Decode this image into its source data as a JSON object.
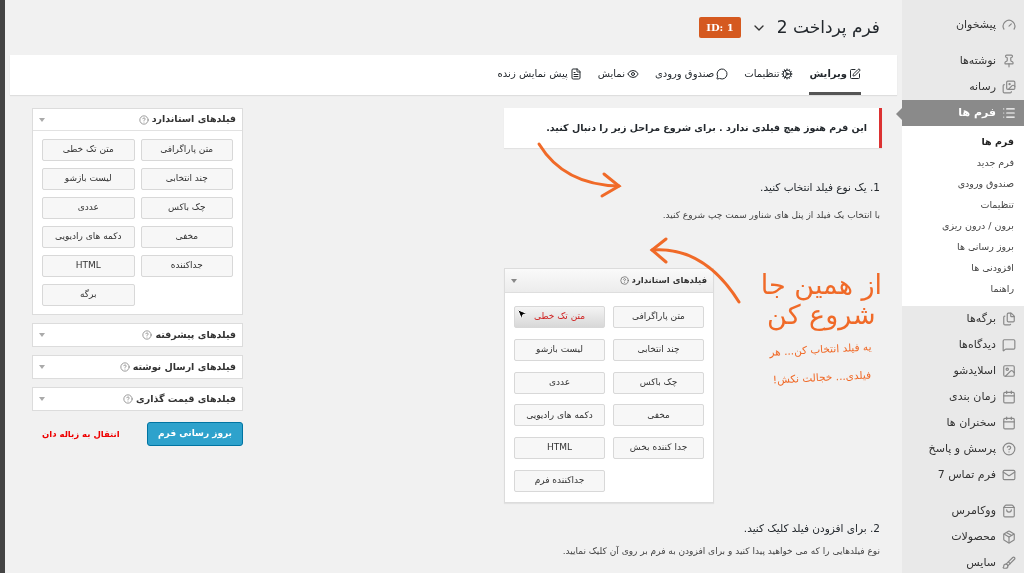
{
  "sidebar": {
    "items": [
      {
        "kind": "item",
        "label": "پیشخوان",
        "selected": false
      },
      {
        "kind": "separator"
      },
      {
        "kind": "item",
        "label": "نوشته‌ها",
        "selected": false
      },
      {
        "kind": "item",
        "label": "رسانه",
        "selected": false
      },
      {
        "kind": "item",
        "label": "فرم ها",
        "selected": true,
        "children": [
          {
            "label": "فرم ها",
            "selected": true
          },
          {
            "label": "فرم جدید",
            "selected": false
          },
          {
            "label": "صندوق ورودی",
            "selected": false
          },
          {
            "label": "تنظیمات",
            "selected": false
          },
          {
            "label": "برون / درون ریزی",
            "selected": false
          },
          {
            "label": "بروز رسانی ها",
            "selected": false
          },
          {
            "label": "افزودنی ها",
            "selected": false
          },
          {
            "label": "راهنما",
            "selected": false
          }
        ]
      },
      {
        "kind": "item",
        "label": "برگه‌ها",
        "selected": false
      },
      {
        "kind": "item",
        "label": "دیدگاه‌ها",
        "selected": false
      },
      {
        "kind": "item",
        "label": "اسلایدشو",
        "selected": false
      },
      {
        "kind": "item",
        "label": "زمان بندی",
        "selected": false
      },
      {
        "kind": "item",
        "label": "سخنران ها",
        "selected": false
      },
      {
        "kind": "item",
        "label": "پرسش و پاسخ",
        "selected": false
      },
      {
        "kind": "item",
        "label": "فرم تماس 7",
        "selected": false
      },
      {
        "kind": "separator"
      },
      {
        "kind": "item",
        "label": "ووکامرس",
        "selected": false
      },
      {
        "kind": "item",
        "label": "محصولات",
        "selected": false
      },
      {
        "kind": "item",
        "label": "سایس",
        "selected": false
      }
    ]
  },
  "header": {
    "title": "فرم پرداخت 2",
    "id_badge": "ID: 1"
  },
  "tabs": [
    {
      "label": "ویرایش",
      "selected": true
    },
    {
      "label": "تنظیمات",
      "selected": false
    },
    {
      "label": "صندوق ورودی",
      "selected": false
    },
    {
      "label": "نمایش",
      "selected": false
    },
    {
      "label": "پیش نمایش زنده",
      "selected": false
    }
  ],
  "notice": "این فرم هنوز هیچ فیلدی ندارد . برای شروع مراحل زیر را دنبال کنید.",
  "steps": [
    {
      "heading": "1. یک نوع فیلد انتخاب کنید.",
      "text": "با انتخاب یک فیلد از پنل های شناور سمت چپ شروع کنید."
    },
    {
      "heading": "2. برای افزودن فیلد کلیک کنید.",
      "text": "نوع فیلدهایی را که می خواهید پیدا کنید و برای افزودن به فرم بر روی آن کلیک نمایید."
    }
  ],
  "tutorial": {
    "panel_title": "فیلدهای استاندارد",
    "buttons": [
      {
        "label": "متن پاراگرافی",
        "hovered": false
      },
      {
        "label": "متن تک خطی",
        "hovered": true
      },
      {
        "label": "چند انتخابی",
        "hovered": false
      },
      {
        "label": "لیست بازشو",
        "hovered": false
      },
      {
        "label": "چک باکس",
        "hovered": false
      },
      {
        "label": "عددی",
        "hovered": false
      },
      {
        "label": "مخفی",
        "hovered": false
      },
      {
        "label": "دکمه های رادیویی",
        "hovered": false
      },
      {
        "label": "جدا کننده بخش",
        "hovered": false
      },
      {
        "label": "HTML",
        "hovered": false
      },
      {
        "label": "جداکننده فرم",
        "hovered": false
      }
    ],
    "handwriting_big": [
      "از همین جا",
      "شروع کن"
    ],
    "handwriting_small": [
      "یه فیلد انتخاب کن... هر",
      "فیلدی... خجالت نکش!"
    ]
  },
  "field_panels": [
    {
      "title": "فیلدهای استاندارد",
      "expanded": true,
      "buttons": [
        "متن پاراگرافی",
        "متن تک خطی",
        "چند انتخابی",
        "لیست بازشو",
        "چک باکس",
        "عددی",
        "مخفی",
        "دکمه های رادیویی",
        "جداکننده",
        "HTML",
        "برگه"
      ]
    },
    {
      "title": "فیلدهای پیشرفته",
      "expanded": false
    },
    {
      "title": "فیلدهای ارسال نوشته",
      "expanded": false
    },
    {
      "title": "فیلدهای قیمت گذاری",
      "expanded": false
    }
  ],
  "actions": {
    "update": "بروز رسانی فرم",
    "trash": "انتقال به زباله دان"
  }
}
